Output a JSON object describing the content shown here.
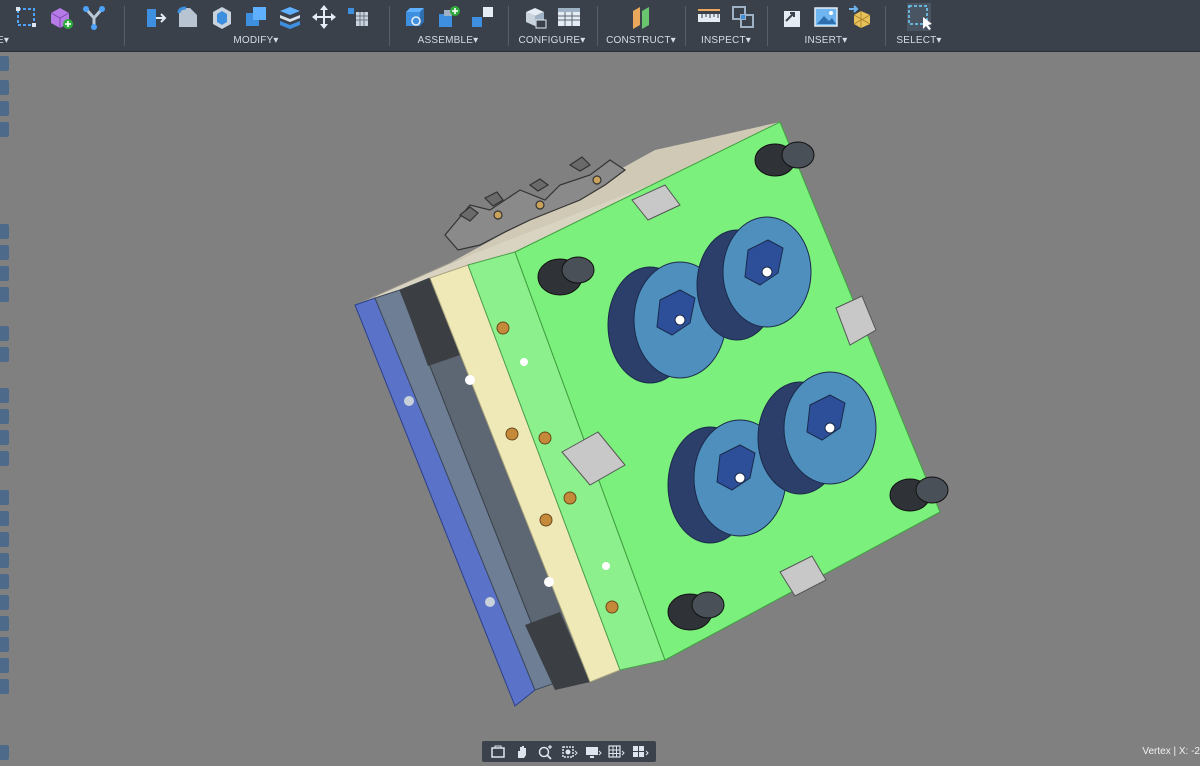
{
  "toolbar": {
    "groups": [
      {
        "label": "E▾",
        "icons": [
          "sketch-rectangle-icon",
          "create-form-icon",
          "branch-icon"
        ]
      },
      {
        "label": "MODIFY▾",
        "icons": [
          "press-pull-icon",
          "fillet-icon",
          "shell-icon",
          "combine-icon",
          "split-body-icon",
          "move-icon",
          "align-icon"
        ]
      },
      {
        "label": "ASSEMBLE▾",
        "icons": [
          "new-component-icon",
          "joint-icon",
          "as-built-joint-icon"
        ]
      },
      {
        "label": "CONFIGURE▾",
        "icons": [
          "configure-icon",
          "table-icon"
        ]
      },
      {
        "label": "CONSTRUCT▾",
        "icons": [
          "offset-plane-icon"
        ]
      },
      {
        "label": "INSPECT▾",
        "icons": [
          "measure-icon",
          "interference-icon"
        ]
      },
      {
        "label": "INSERT▾",
        "icons": [
          "insert-derive-icon",
          "insert-image-icon",
          "insert-mesh-icon"
        ]
      },
      {
        "label": "SELECT▾",
        "icons": [
          "select-window-icon"
        ]
      }
    ]
  },
  "status_bar": {
    "text": "Vertex | X: -2"
  },
  "navigation_bar": {
    "icons": [
      "orbit-icon",
      "pan-icon",
      "zoom-icon",
      "fit-icon",
      "display-settings-icon",
      "grid-icon",
      "viewports-icon"
    ]
  },
  "colors": {
    "toolbar_bg": "#3a414a",
    "canvas_bg": "#808080",
    "plate_green": "#7cf07c",
    "plate_cream": "#efe9b8",
    "plate_blue": "#6e7f95",
    "cavity_blue": "#4e8fbe"
  }
}
